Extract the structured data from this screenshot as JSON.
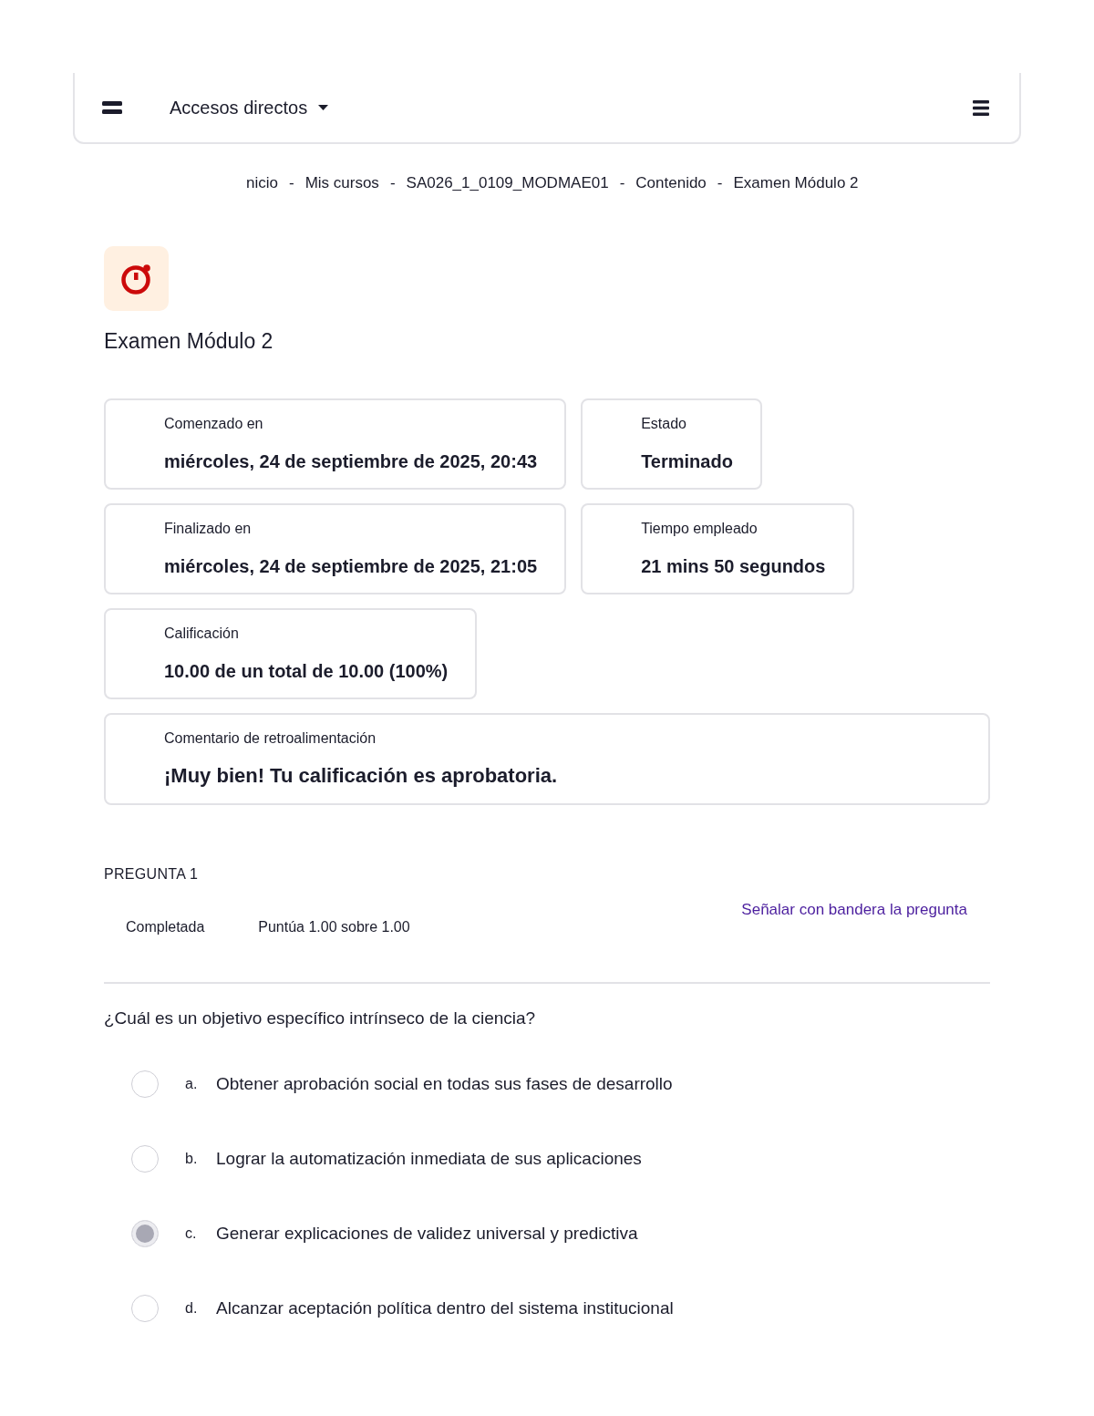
{
  "navbar": {
    "shortcuts": {
      "label": "Accesos directos"
    }
  },
  "breadcrumb": {
    "separator": "-",
    "items": [
      "nicio",
      "Mis cursos",
      "SA026_1_0109_MODMAE01",
      "Contenido",
      "Examen Módulo 2"
    ]
  },
  "activity": {
    "title": "Examen Módulo 2"
  },
  "summary_rows": [
    [
      {
        "label": "Comenzado en",
        "value": "miércoles, 24 de septiembre de 2025, 20:43"
      },
      {
        "label": "Estado",
        "value": "Terminado"
      }
    ],
    [
      {
        "label": "Finalizado en",
        "value": "miércoles, 24 de septiembre de 2025, 21:05"
      },
      {
        "label": "Tiempo empleado",
        "value": "21 mins 50 segundos"
      }
    ],
    [
      {
        "label": "Calificación",
        "value": "10.00 de un total de 10.00 (100%)"
      }
    ]
  ],
  "feedback": {
    "label": "Comentario de retroalimentación",
    "value": "¡Muy bien! Tu calificación es aprobatoria."
  },
  "question": {
    "heading": "PREGUNTA 1",
    "status": "Completada",
    "grade": "Puntúa 1.00 sobre 1.00",
    "flag_link": "Señalar con bandera la pregunta",
    "text": "¿Cuál es un objetivo específico intrínseco de la ciencia?",
    "options": [
      {
        "letter": "a.",
        "text": "Obtener aprobación social en todas sus fases de desarrollo",
        "selected": false
      },
      {
        "letter": "b.",
        "text": "Lograr la automatización inmediata de sus aplicaciones",
        "selected": false
      },
      {
        "letter": "c.",
        "text": "Generar explicaciones de validez universal y predictiva",
        "selected": true
      },
      {
        "letter": "d.",
        "text": "Alcanzar aceptación política dentro del sistema institucional",
        "selected": false
      }
    ]
  }
}
